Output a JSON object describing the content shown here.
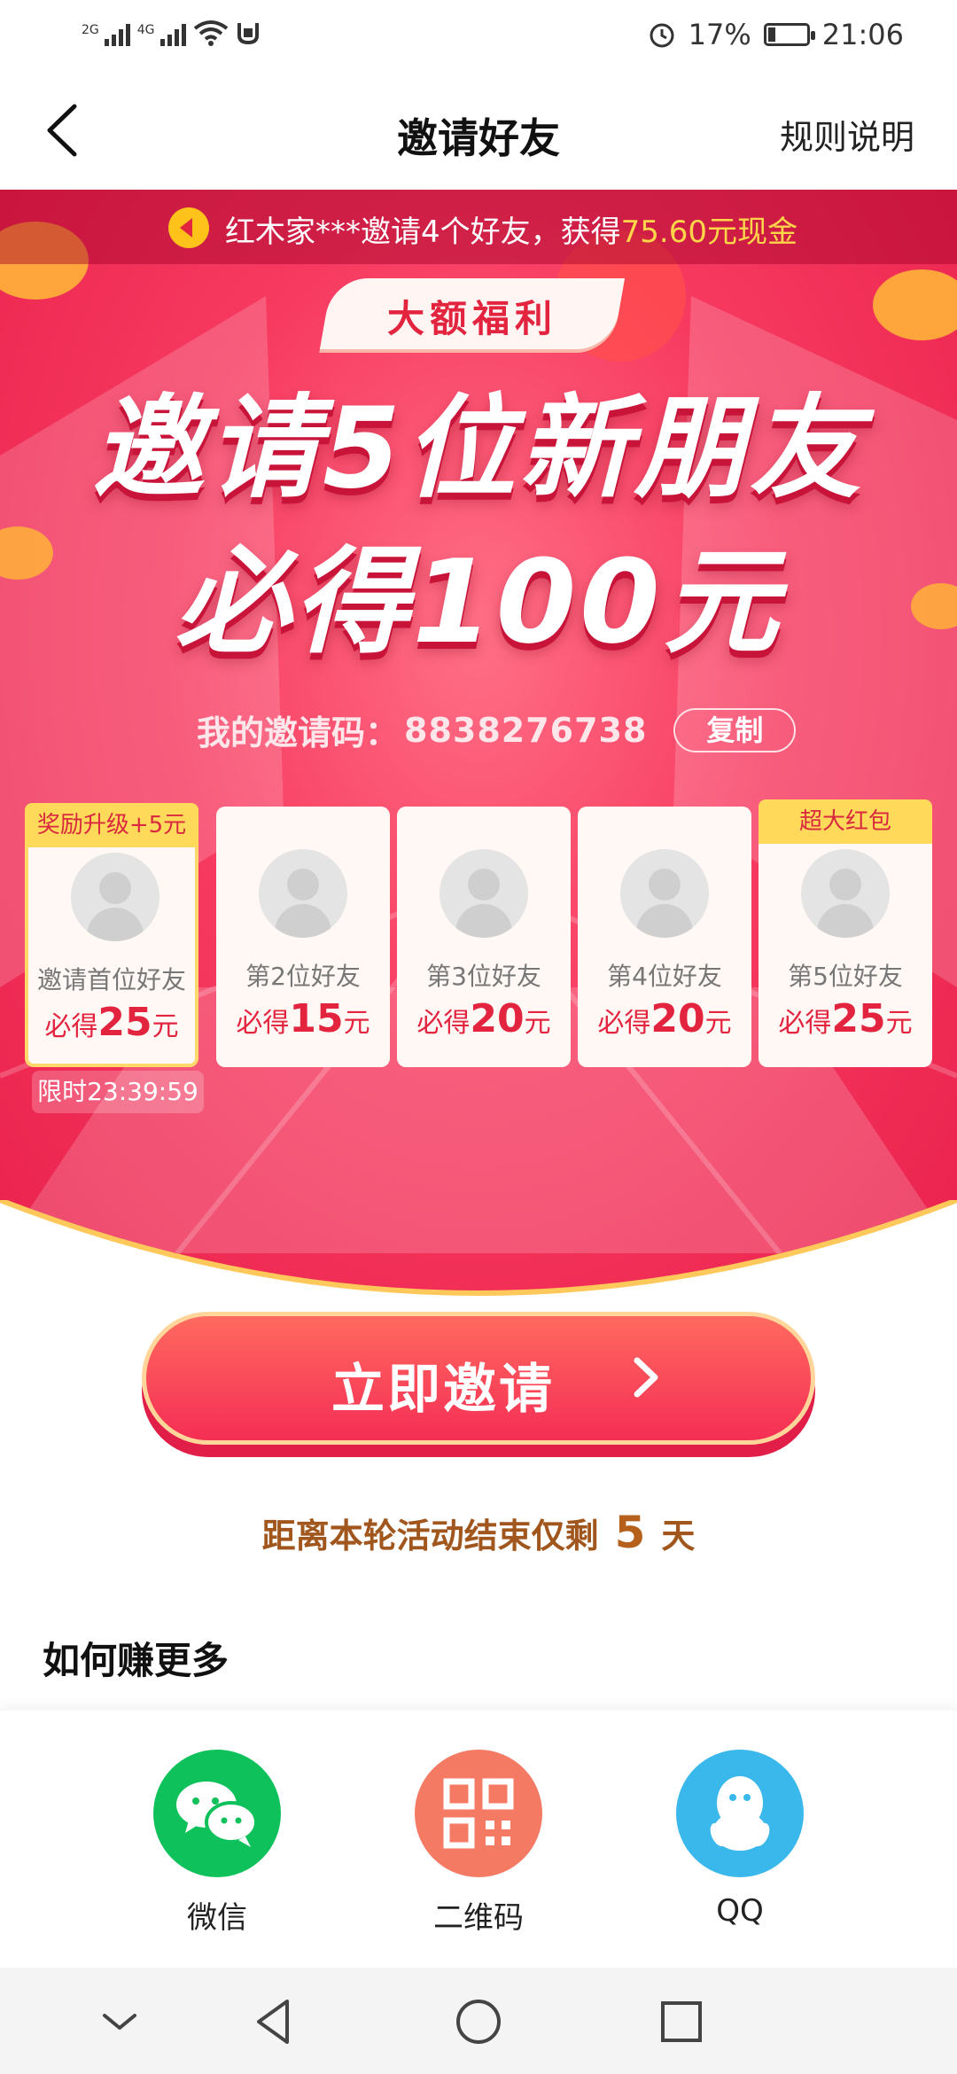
{
  "status_bar": {
    "net1": "2G",
    "net2": "4G",
    "battery": "17%",
    "time": "21:06"
  },
  "header": {
    "title": "邀请好友",
    "rules": "规则说明"
  },
  "ticker": {
    "prefix": "红木家***邀请4个好友，获得",
    "amount": "75.60元现金"
  },
  "hero": {
    "badge": "大额福利",
    "headline_line1": "邀请5位新朋友",
    "headline_line2": "必得100元"
  },
  "invite_code": {
    "label": "我的邀请码：",
    "value": "8838276738",
    "copy": "复制"
  },
  "friend_cards": [
    {
      "tag": "奖励升级+5元",
      "label": "邀请首位好友",
      "prefix": "必得",
      "amount": "25",
      "suffix": "元"
    },
    {
      "tag": "",
      "label": "第2位好友",
      "prefix": "必得",
      "amount": "15",
      "suffix": "元"
    },
    {
      "tag": "",
      "label": "第3位好友",
      "prefix": "必得",
      "amount": "20",
      "suffix": "元"
    },
    {
      "tag": "",
      "label": "第4位好友",
      "prefix": "必得",
      "amount": "20",
      "suffix": "元"
    },
    {
      "tag": "超大红包",
      "label": "第5位好友",
      "prefix": "必得",
      "amount": "25",
      "suffix": "元"
    }
  ],
  "timer": "限时23:39:59",
  "cta": {
    "invite": "立即邀请"
  },
  "countdown": {
    "prefix": "距离本轮活动结束仅剩",
    "days": "5",
    "suffix": "天"
  },
  "section": {
    "title": "如何赚更多"
  },
  "share": [
    {
      "label": "微信",
      "icon": "wechat-icon",
      "color": "#0fc15a"
    },
    {
      "label": "二维码",
      "icon": "qrcode-icon",
      "color": "#f47a63"
    },
    {
      "label": "QQ",
      "icon": "qq-icon",
      "color": "#3ab8ec"
    }
  ],
  "colors": {
    "brand_red": "#f73a60",
    "gold": "#ffd54a",
    "countdown": "#a0561c"
  }
}
